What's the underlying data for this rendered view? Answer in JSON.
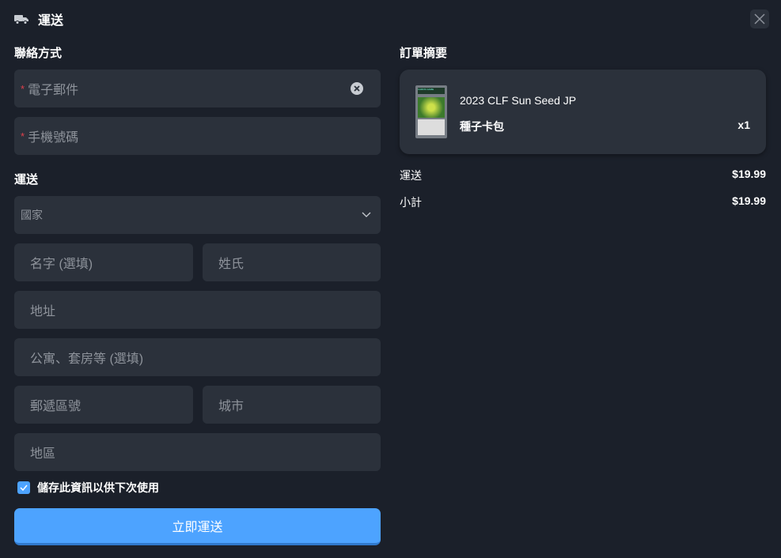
{
  "header": {
    "title": "運送",
    "icon": "truck-icon",
    "close_icon": "close-icon"
  },
  "contact": {
    "heading": "聯絡方式",
    "email_placeholder": "電子郵件",
    "phone_placeholder": "手機號碼",
    "required_mark": "*"
  },
  "shipping": {
    "heading": "運送",
    "country_placeholder": "國家",
    "first_name": "名字 (選填)",
    "last_name": "姓氏",
    "address": "地址",
    "apartment": "公寓、套房等 (選填)",
    "postal": "郵遞區號",
    "city": "城市",
    "region": "地區"
  },
  "save_info": {
    "label": "儲存此資訊以供下次使用",
    "checked": true
  },
  "submit_label": "立即運送",
  "summary": {
    "heading": "訂單摘要",
    "item": {
      "name": "2023 CLF Sun Seed JP",
      "variant": "種子卡包",
      "qty": "x1",
      "thumb_label": "CARDS GAME"
    },
    "lines": [
      {
        "label": "運送",
        "value": "$19.99"
      },
      {
        "label": "小計",
        "value": "$19.99"
      }
    ]
  },
  "colors": {
    "accent": "#4da3ff",
    "bg": "#1b202a",
    "field": "#2b313b"
  }
}
